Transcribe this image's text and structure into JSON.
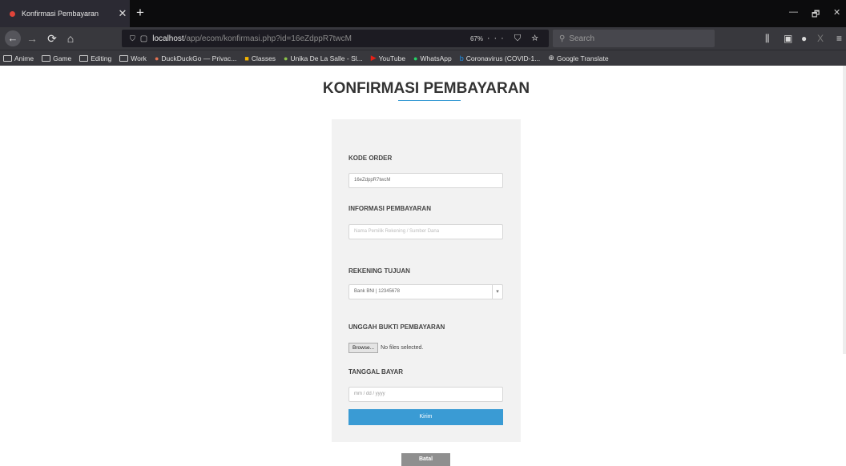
{
  "browser": {
    "tab_title": "Konfirmasi Pembayaran",
    "tab_close": "✕",
    "new_tab": "+",
    "url_host": "localhost",
    "url_path": "/app/ecom/konfirmasi.php?id=16eZdppR7twcM",
    "zoom": "67%",
    "search_placeholder": "Search",
    "window_controls": [
      "—",
      "🗗",
      "✕"
    ]
  },
  "bookmarks": [
    {
      "label": "Anime",
      "icon": "folder-icon"
    },
    {
      "label": "Game",
      "icon": "folder-icon"
    },
    {
      "label": "Editing",
      "icon": "folder-icon"
    },
    {
      "label": "Work",
      "icon": "folder-icon"
    },
    {
      "label": "DuckDuckGo — Privac...",
      "icon": "duckduckgo-icon"
    },
    {
      "label": "Classes",
      "icon": "classroom-icon"
    },
    {
      "label": "Unika De La Salle - Sl...",
      "icon": "unika-icon"
    },
    {
      "label": "YouTube",
      "icon": "youtube-icon"
    },
    {
      "label": "WhatsApp",
      "icon": "whatsapp-icon"
    },
    {
      "label": "Coronavirus (COVID-1...",
      "icon": "bing-icon"
    },
    {
      "label": "Google Translate",
      "icon": "globe-icon"
    }
  ],
  "page": {
    "title": "KONFIRMASI PEMBAYARAN",
    "accent_color": "#3a9bd4",
    "form": {
      "kode_order_label": "KODE ORDER",
      "kode_order_value": "16eZdppR7twcM",
      "informasi_label": "INFORMASI PEMBAYARAN",
      "informasi_placeholder": "Nama Pemilik Rekening / Sumber Dana",
      "rekening_label": "REKENING TUJUAN",
      "rekening_value": "Bank BNI | 12345678",
      "unggah_label": "UNGGAH BUKTI PEMBAYARAN",
      "browse_label": "Browse...",
      "file_status": "No files selected.",
      "tanggal_label": "TANGGAL BAYAR",
      "tanggal_placeholder": "mm / dd / yyyy",
      "kirim_label": "Kirim"
    },
    "batal_label": "Batal"
  }
}
